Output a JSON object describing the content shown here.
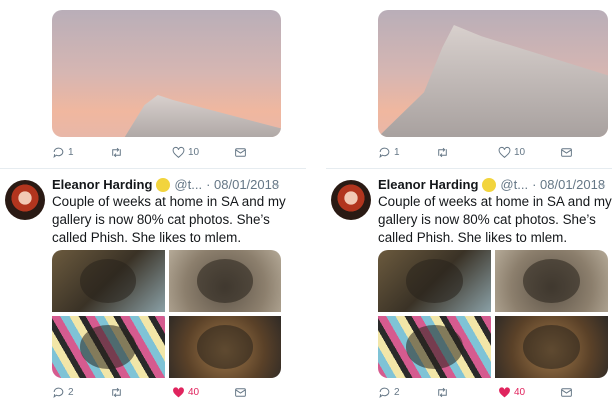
{
  "panels": [
    {
      "top_actions": {
        "reply": "1",
        "retweet": "",
        "like": "10"
      },
      "tweet": {
        "name": "Eleanor Harding",
        "handle": "@t...",
        "date": "· 08/01/2018",
        "text": "Couple of weeks at home in SA and my gallery is now 80% cat photos. She’s called Phish. She likes to mlem.",
        "actions": {
          "reply": "2",
          "like": "40"
        }
      }
    },
    {
      "top_actions": {
        "reply": "1",
        "retweet": "",
        "like": "10"
      },
      "tweet": {
        "name": "Eleanor Harding",
        "handle": "@t...",
        "date": "· 08/01/2018",
        "text": "Couple of weeks at home in SA and my gallery is now 80% cat photos. She’s called Phish. She likes to mlem.",
        "actions": {
          "reply": "2",
          "like": "40"
        }
      }
    }
  ],
  "colors": {
    "like_active": "#e0245e",
    "icon": "#657786"
  }
}
